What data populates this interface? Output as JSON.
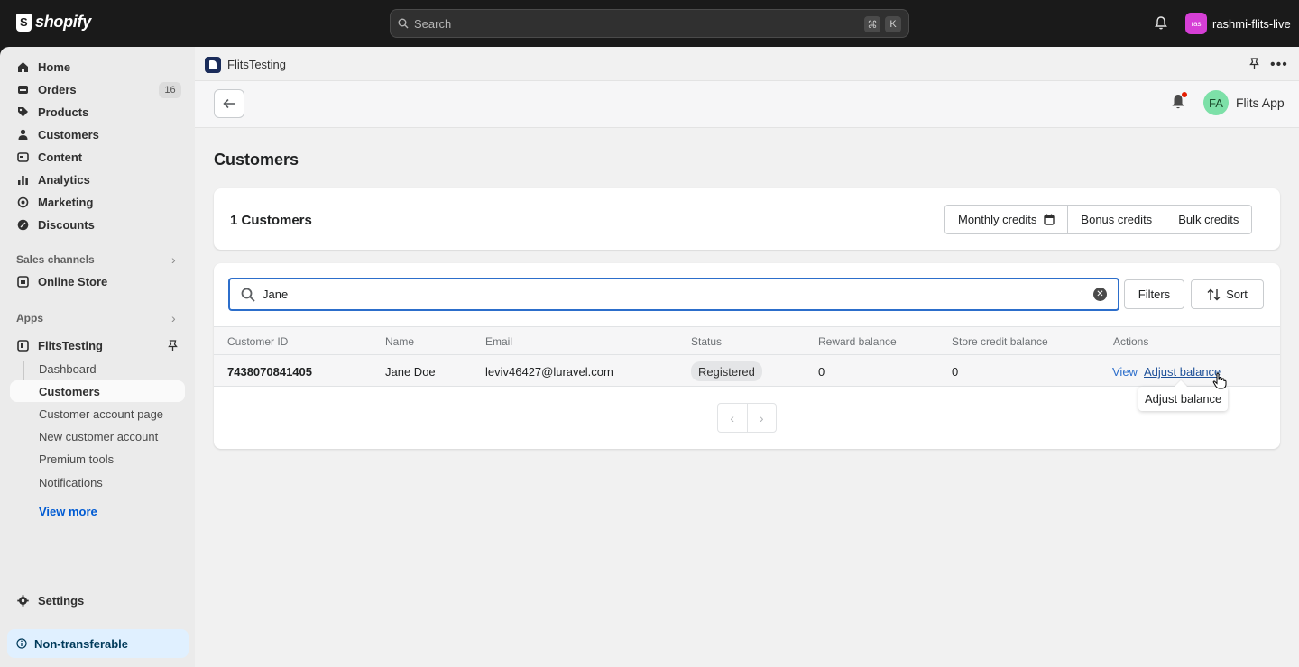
{
  "topbar": {
    "brand": "shopify",
    "search_placeholder": "Search",
    "shortcut_keys": [
      "⌘",
      "K"
    ],
    "store_avatar_initials": "ras",
    "store_name": "rashmi-flits-live"
  },
  "sidebar": {
    "items": [
      {
        "label": "Home",
        "icon": "home-icon"
      },
      {
        "label": "Orders",
        "icon": "orders-icon",
        "badge": "16"
      },
      {
        "label": "Products",
        "icon": "tag-icon"
      },
      {
        "label": "Customers",
        "icon": "person-icon"
      },
      {
        "label": "Content",
        "icon": "content-icon"
      },
      {
        "label": "Analytics",
        "icon": "bar-chart-icon"
      },
      {
        "label": "Marketing",
        "icon": "target-icon"
      },
      {
        "label": "Discounts",
        "icon": "discount-icon"
      }
    ],
    "sales_channels_heading": "Sales channels",
    "online_store": "Online Store",
    "apps_heading": "Apps",
    "app_name": "FlitsTesting",
    "app_subitems": [
      "Dashboard",
      "Customers",
      "Customer account page",
      "New customer account",
      "Premium tools",
      "Notifications"
    ],
    "active_subitem": "Customers",
    "view_more": "View more",
    "settings": "Settings",
    "non_transferable": "Non-transferable"
  },
  "appbar": {
    "app_name": "FlitsTesting"
  },
  "header": {
    "avatar_initials": "FA",
    "app_label": "Flits App"
  },
  "page": {
    "title": "Customers",
    "count_label": "1 Customers",
    "credit_buttons": [
      "Monthly credits",
      "Bonus credits",
      "Bulk credits"
    ],
    "search_value": "Jane",
    "filters_label": "Filters",
    "sort_label": "Sort"
  },
  "table": {
    "columns": [
      "Customer ID",
      "Name",
      "Email",
      "Status",
      "Reward balance",
      "Store credit balance",
      "Actions"
    ],
    "rows": [
      {
        "customer_id": "7438070841405",
        "name": "Jane Doe",
        "email": "leviv46427@luravel.com",
        "status": "Registered",
        "reward_balance": "0",
        "store_credit_balance": "0",
        "actions": [
          "View",
          "Adjust balance"
        ]
      }
    ]
  },
  "tooltip": "Adjust balance",
  "colors": {
    "topbar_bg": "#1a1a1a",
    "sidebar_bg": "#ebebeb",
    "link": "#2c6ecb",
    "focus_border": "#2c6ecb",
    "notification_dot": "#e51c00",
    "store_avatar": "#d63fd6",
    "app_avatar": "#7de0a8"
  }
}
